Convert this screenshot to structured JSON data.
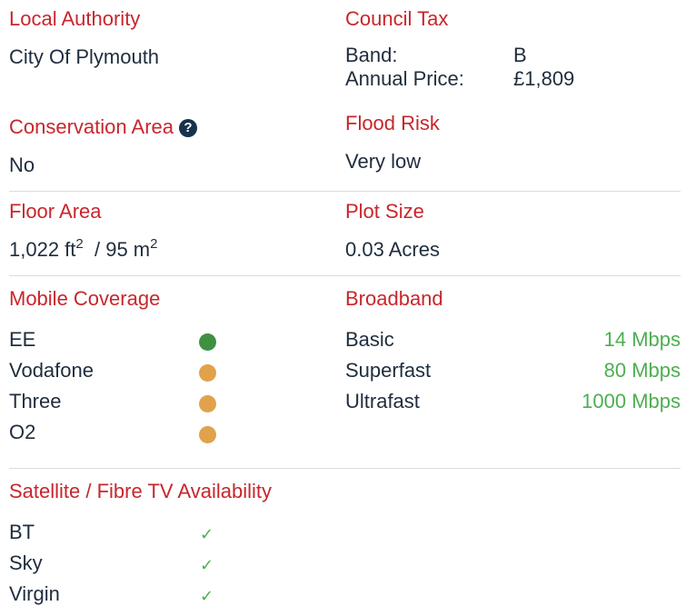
{
  "local_authority": {
    "heading": "Local Authority",
    "value": "City Of Plymouth"
  },
  "council_tax": {
    "heading": "Council Tax",
    "band_label": "Band:",
    "band_value": "B",
    "price_label": "Annual Price:",
    "price_value": "£1,809"
  },
  "conservation_area": {
    "heading": "Conservation Area",
    "help_icon": "?",
    "value": "No"
  },
  "flood_risk": {
    "heading": "Flood Risk",
    "value": "Very low"
  },
  "floor_area": {
    "heading": "Floor Area",
    "ft_value": "1,022 ft",
    "ft_sup": "2",
    "sep": "/",
    "m_value": "95 m",
    "m_sup": "2"
  },
  "plot_size": {
    "heading": "Plot Size",
    "value": "0.03 Acres"
  },
  "mobile_coverage": {
    "heading": "Mobile Coverage",
    "items": [
      {
        "name": "EE",
        "status": "good",
        "color": "#3f9142"
      },
      {
        "name": "Vodafone",
        "status": "fair",
        "color": "#e0a24a"
      },
      {
        "name": "Three",
        "status": "fair",
        "color": "#e0a24a"
      },
      {
        "name": "O2",
        "status": "fair",
        "color": "#e0a24a"
      }
    ]
  },
  "broadband": {
    "heading": "Broadband",
    "items": [
      {
        "name": "Basic",
        "speed": "14 Mbps"
      },
      {
        "name": "Superfast",
        "speed": "80 Mbps"
      },
      {
        "name": "Ultrafast",
        "speed": "1000 Mbps"
      }
    ]
  },
  "tv": {
    "heading": "Satellite / Fibre TV Availability",
    "items": [
      {
        "name": "BT",
        "icon": "check-icon",
        "glyph": "✓"
      },
      {
        "name": "Sky",
        "icon": "check-icon",
        "glyph": "✓"
      },
      {
        "name": "Virgin",
        "icon": "check-icon",
        "glyph": "✓"
      }
    ]
  },
  "colors": {
    "heading": "#c8262c",
    "text": "#1f2d3d",
    "speed": "#4caf50",
    "check": "#4caf50"
  }
}
